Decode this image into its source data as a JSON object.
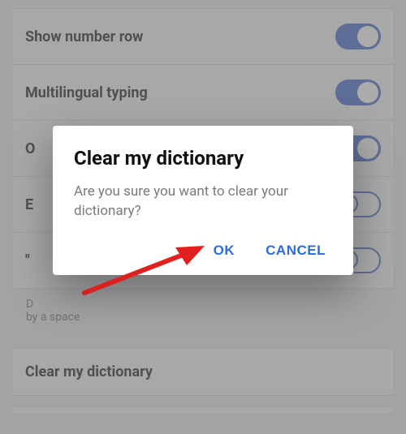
{
  "settings": {
    "rows": [
      {
        "label": "Show number row",
        "toggle": "on"
      },
      {
        "label": "Multilingual typing",
        "toggle": "on"
      },
      {
        "label": "O",
        "toggle": "on"
      },
      {
        "label": "E",
        "toggle": "off"
      },
      {
        "label": "\"",
        "toggle": "off"
      }
    ],
    "hint_line1": "D",
    "hint_line2": "by a space",
    "clear_row_label": "Clear my dictionary"
  },
  "dialog": {
    "title": "Clear my dictionary",
    "body": "Are you sure you want to clear your dictionary?",
    "ok": "OK",
    "cancel": "CANCEL"
  }
}
